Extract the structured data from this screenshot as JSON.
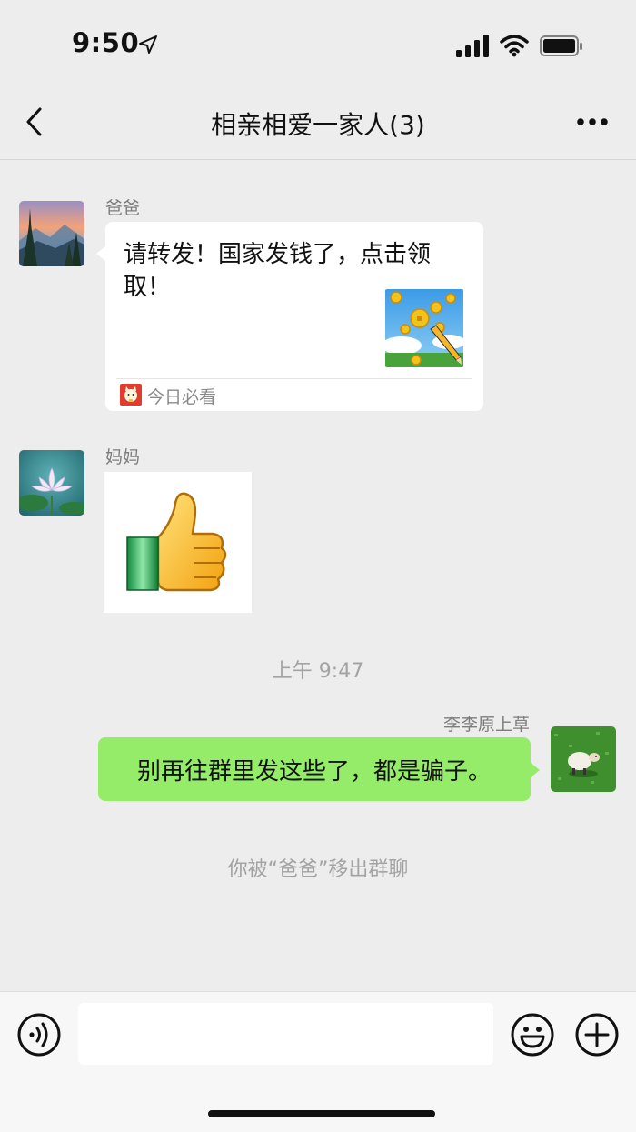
{
  "status_bar": {
    "time": "9:50",
    "icons": [
      "location-arrow-icon",
      "cellular-signal-icon",
      "wifi-icon",
      "battery-icon"
    ]
  },
  "nav": {
    "title": "相亲相爱一家人(3)",
    "back_icon": "chevron-left-icon",
    "more_icon": "ellipsis-icon"
  },
  "messages": [
    {
      "sender": "爸爸",
      "type": "link-card",
      "title": "请转发！国家发钱了，点击领取！",
      "source": "今日必看"
    },
    {
      "sender": "妈妈",
      "type": "sticker",
      "sticker": "thumbs-up"
    },
    {
      "type": "timestamp",
      "text": "上午 9:47"
    },
    {
      "sender": "李李原上草",
      "type": "text",
      "self": true,
      "text": "别再往群里发这些了，都是骗子。"
    },
    {
      "type": "system",
      "text": "你被“爸爸”移出群聊"
    }
  ],
  "input_bar": {
    "placeholder": "",
    "icons": [
      "voice-icon",
      "emoji-icon",
      "plus-icon"
    ]
  },
  "colors": {
    "background": "#ededed",
    "my_bubble": "#95ec69",
    "card": "#ffffff",
    "muted_text": "#a3a3a3"
  }
}
